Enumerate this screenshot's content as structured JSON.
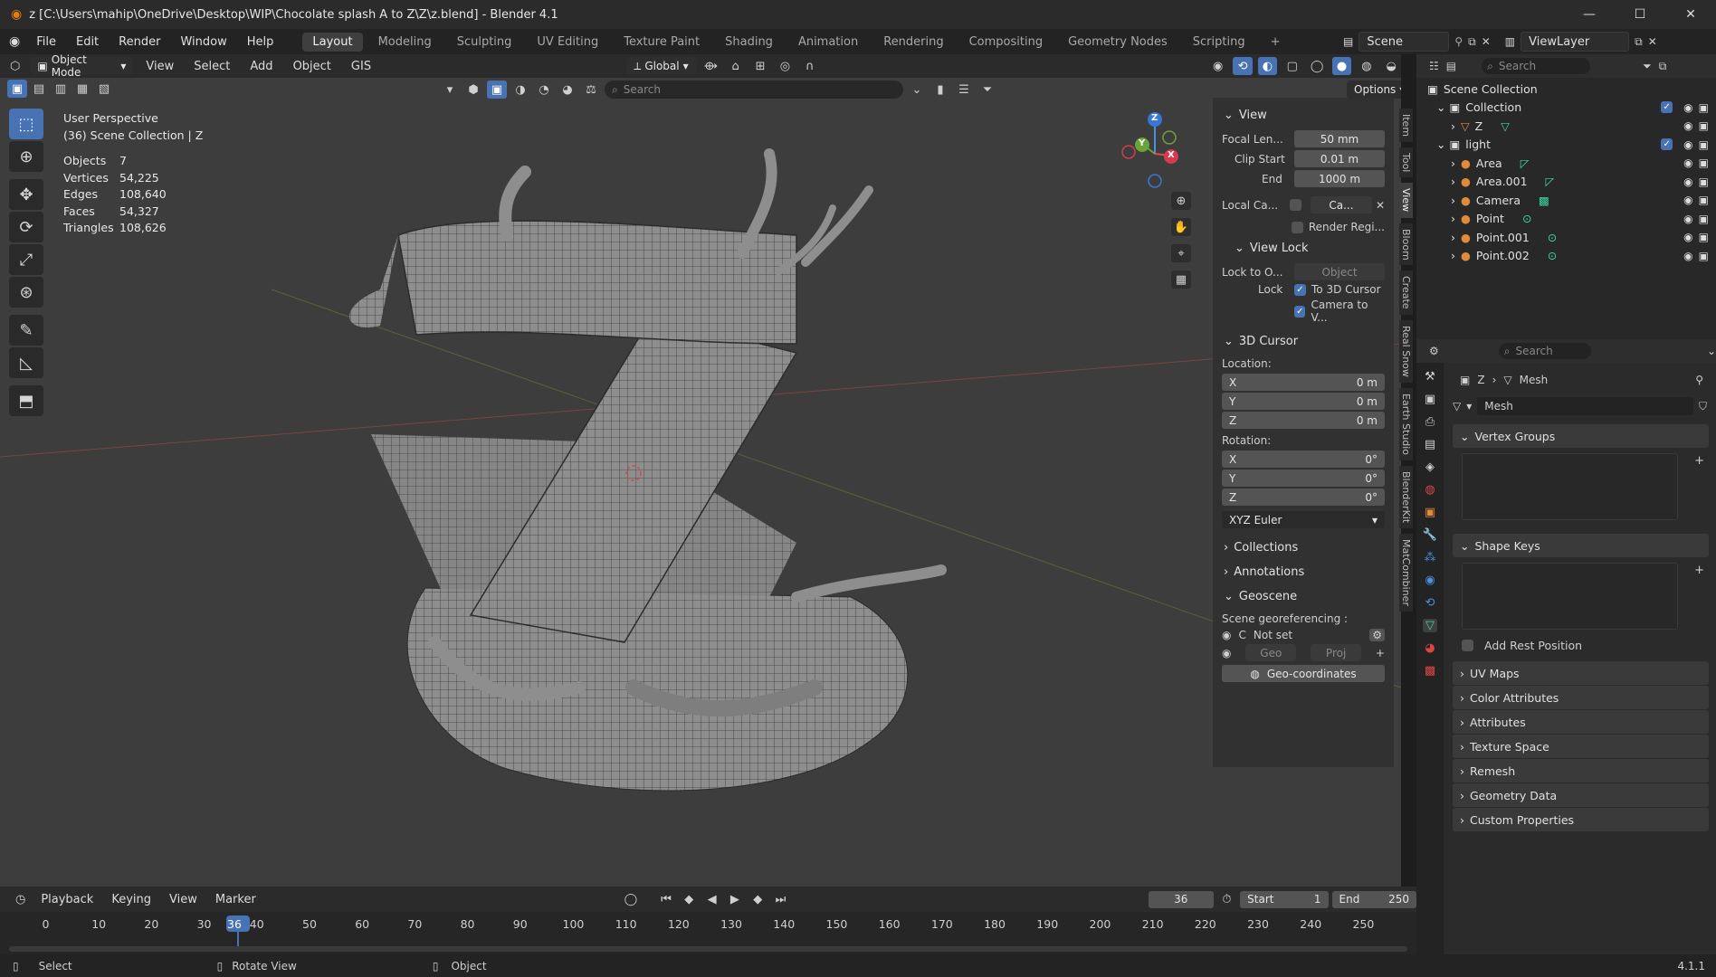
{
  "window": {
    "title": "z [C:\\Users\\mahip\\OneDrive\\Desktop\\WIP\\Chocolate splash A to Z\\Z\\z.blend] - Blender 4.1",
    "controls": {
      "min": "—",
      "max": "☐",
      "close": "✕"
    }
  },
  "menubar": {
    "menus": [
      "File",
      "Edit",
      "Render",
      "Window",
      "Help"
    ],
    "workspaces": [
      "Layout",
      "Modeling",
      "Sculpting",
      "UV Editing",
      "Texture Paint",
      "Shading",
      "Animation",
      "Rendering",
      "Compositing",
      "Geometry Nodes",
      "Scripting"
    ],
    "active_workspace": "Layout",
    "add_tab": "+",
    "scene": "Scene",
    "view_layer": "ViewLayer"
  },
  "viewport_header": {
    "mode": "Object Mode",
    "menus": [
      "View",
      "Select",
      "Add",
      "Object",
      "GIS"
    ],
    "orientation": "Global",
    "search_placeholder": "Search",
    "options": "Options"
  },
  "viewport_overlay": {
    "perspective": "User Perspective",
    "collection": "(36) Scene Collection | Z",
    "stats": [
      {
        "label": "Objects",
        "value": "7"
      },
      {
        "label": "Vertices",
        "value": "54,225"
      },
      {
        "label": "Edges",
        "value": "108,640"
      },
      {
        "label": "Faces",
        "value": "54,327"
      },
      {
        "label": "Triangles",
        "value": "108,626"
      }
    ],
    "gizmo": {
      "x": "X",
      "y": "Y",
      "z": "Z"
    }
  },
  "npanel": {
    "view_header": "View",
    "focal_label": "Focal Len...",
    "focal_value": "50 mm",
    "clip_start_label": "Clip Start",
    "clip_start_value": "0.01 m",
    "clip_end_label": "End",
    "clip_end_value": "1000 m",
    "local_camera_label": "Local Ca...",
    "local_camera_value": "Ca...",
    "render_region": "Render Regi...",
    "view_lock_header": "View Lock",
    "lock_to_label": "Lock to O...",
    "lock_to_placeholder": "Object",
    "lock_label": "Lock",
    "to_3d_cursor": "To 3D Cursor",
    "camera_to_view": "Camera to V...",
    "cursor_header": "3D Cursor",
    "location_label": "Location:",
    "loc": [
      {
        "axis": "X",
        "value": "0 m"
      },
      {
        "axis": "Y",
        "value": "0 m"
      },
      {
        "axis": "Z",
        "value": "0 m"
      }
    ],
    "rotation_label": "Rotation:",
    "rot": [
      {
        "axis": "X",
        "value": "0°"
      },
      {
        "axis": "Y",
        "value": "0°"
      },
      {
        "axis": "Z",
        "value": "0°"
      }
    ],
    "rotation_mode": "XYZ Euler",
    "collections": "Collections",
    "annotations": "Annotations",
    "geoscene": "Geoscene",
    "scene_georef": "Scene georeferencing :",
    "georef_code": "C",
    "georef_value": "Not set",
    "geo_btn": "Geo",
    "proj_btn": "Proj",
    "geo_coords": "Geo-coordinates",
    "tabs": [
      "Item",
      "Tool",
      "View",
      "Bloom",
      "Create",
      "Real Snow",
      "Earth Studio",
      "BlenderKit",
      "MatCombiner"
    ]
  },
  "outliner": {
    "search_placeholder": "Search",
    "rows": [
      {
        "label": "Scene Collection",
        "indent": 0
      },
      {
        "label": "Collection",
        "indent": 1
      },
      {
        "label": "Z",
        "indent": 2
      },
      {
        "label": "light",
        "indent": 1
      },
      {
        "label": "Area",
        "indent": 2
      },
      {
        "label": "Area.001",
        "indent": 2
      },
      {
        "label": "Camera",
        "indent": 2
      },
      {
        "label": "Point",
        "indent": 2
      },
      {
        "label": "Point.001",
        "indent": 2
      },
      {
        "label": "Point.002",
        "indent": 2
      }
    ]
  },
  "properties": {
    "search_placeholder": "Search",
    "breadcrumb_object": "Z",
    "breadcrumb_data": "Mesh",
    "mesh_name": "Mesh",
    "sections_top": [
      "Vertex Groups",
      "Shape Keys"
    ],
    "add_rest_position": "Add Rest Position",
    "sections": [
      "UV Maps",
      "Color Attributes",
      "Attributes",
      "Texture Space",
      "Remesh",
      "Geometry Data",
      "Custom Properties"
    ]
  },
  "timeline": {
    "menus": [
      "Playback",
      "Keying",
      "View",
      "Marker"
    ],
    "current_frame": "36",
    "start_label": "Start",
    "start_value": "1",
    "end_label": "End",
    "end_value": "250",
    "ticks": [
      "0",
      "10",
      "20",
      "30",
      "40",
      "50",
      "60",
      "70",
      "80",
      "90",
      "100",
      "110",
      "120",
      "130",
      "140",
      "150",
      "160",
      "170",
      "180",
      "190",
      "200",
      "210",
      "220",
      "230",
      "240",
      "250"
    ]
  },
  "statusbar": {
    "select": "Select",
    "rotate": "Rotate View",
    "object": "Object",
    "version": "4.1.1"
  }
}
